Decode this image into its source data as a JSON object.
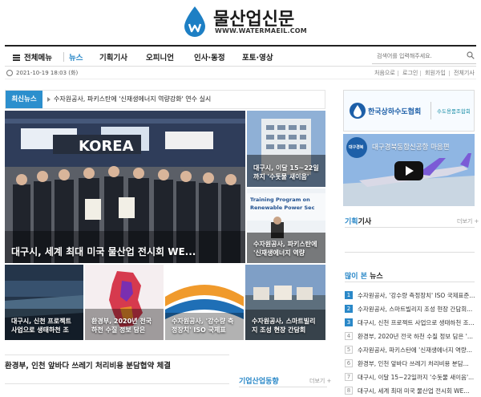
{
  "site": {
    "title": "물산업신문",
    "url": "WWW.WATERMAEIL.COM"
  },
  "nav": {
    "all_menu": "전체메뉴",
    "items": [
      "뉴스",
      "기획기사",
      "오피니언",
      "인사·동정",
      "포토·영상"
    ],
    "active": "뉴스",
    "search_placeholder": "검색어를 입력해주세요."
  },
  "date_row": {
    "date": "2021-10-19 18:03 (화)",
    "links": [
      "처음으로",
      "로그인",
      "회원가입",
      "전체기사"
    ]
  },
  "breaking": {
    "label": "최신뉴스",
    "headline": "수자원공사, 파키스탄에 '신재생에너지 역량강화' 연수 실시"
  },
  "main_story": {
    "caption": "대구시, 세계 최대 미국 물산업 전시회 WE...",
    "photo_text": "KOREA"
  },
  "side_tiles": [
    {
      "caption": "대구시, 이달 15~22일까지 '수돗물 새이음'",
      "photo_text": ""
    },
    {
      "caption": "수자원공사, 파키스탄에 '신재생에너지 역량",
      "photo_text": "Training Program on Renewable Power Sec"
    }
  ],
  "bottom_tiles": [
    {
      "caption": "대구시, 신천 프로젝트 사업으로 생태하천 조"
    },
    {
      "caption": "환경부, 2020년 전국 하천 수질 정보 담은"
    },
    {
      "caption": "수자원공사, '강수량 측정장치' ISO 국제표"
    },
    {
      "caption": "수자원공사, 스마트빌리지 조성 현장 간담회"
    }
  ],
  "lower_headline": "환경부, 인천 앞바다 쓰레기 처리비용 분담협약 체결",
  "corporate": {
    "title": "기업산업동향",
    "more": "더보기 +"
  },
  "ads": {
    "ad1_text": "한국상하수도협회",
    "ad1_sub": "수도용품조합회",
    "ad2_text": "대구경북동합신공항 마음편",
    "ad2_badge": "대구경북"
  },
  "planning": {
    "title_prefix": "기획",
    "title_suffix": "기사",
    "more": "더보기 +"
  },
  "popular": {
    "title_prefix": "많이 본",
    "title_suffix": " 뉴스",
    "items": [
      "수자원공사, '강수량 측정장치' ISO 국제표준...",
      "수자원공사, 스마트빌리지 조성 현장 간담회...",
      "대구시, 신천 프로젝트 사업으로 생태하천 조...",
      "환경부, 2020년 전국 하천 수질 정보 담은 '...",
      "수자원공사, 파키스탄에 '신재생에너지 역량...",
      "환경부, 인천 앞바다 쓰레기 처리비용 분담...",
      "대구시, 이달 15~22일까지 '수돗물 새이음'...",
      "대구시, 세계 최대 미국 물산업 전시회 WE..."
    ]
  },
  "colors": {
    "accent": "#2a88c8",
    "breaking_bg": "#2c8fcd"
  }
}
